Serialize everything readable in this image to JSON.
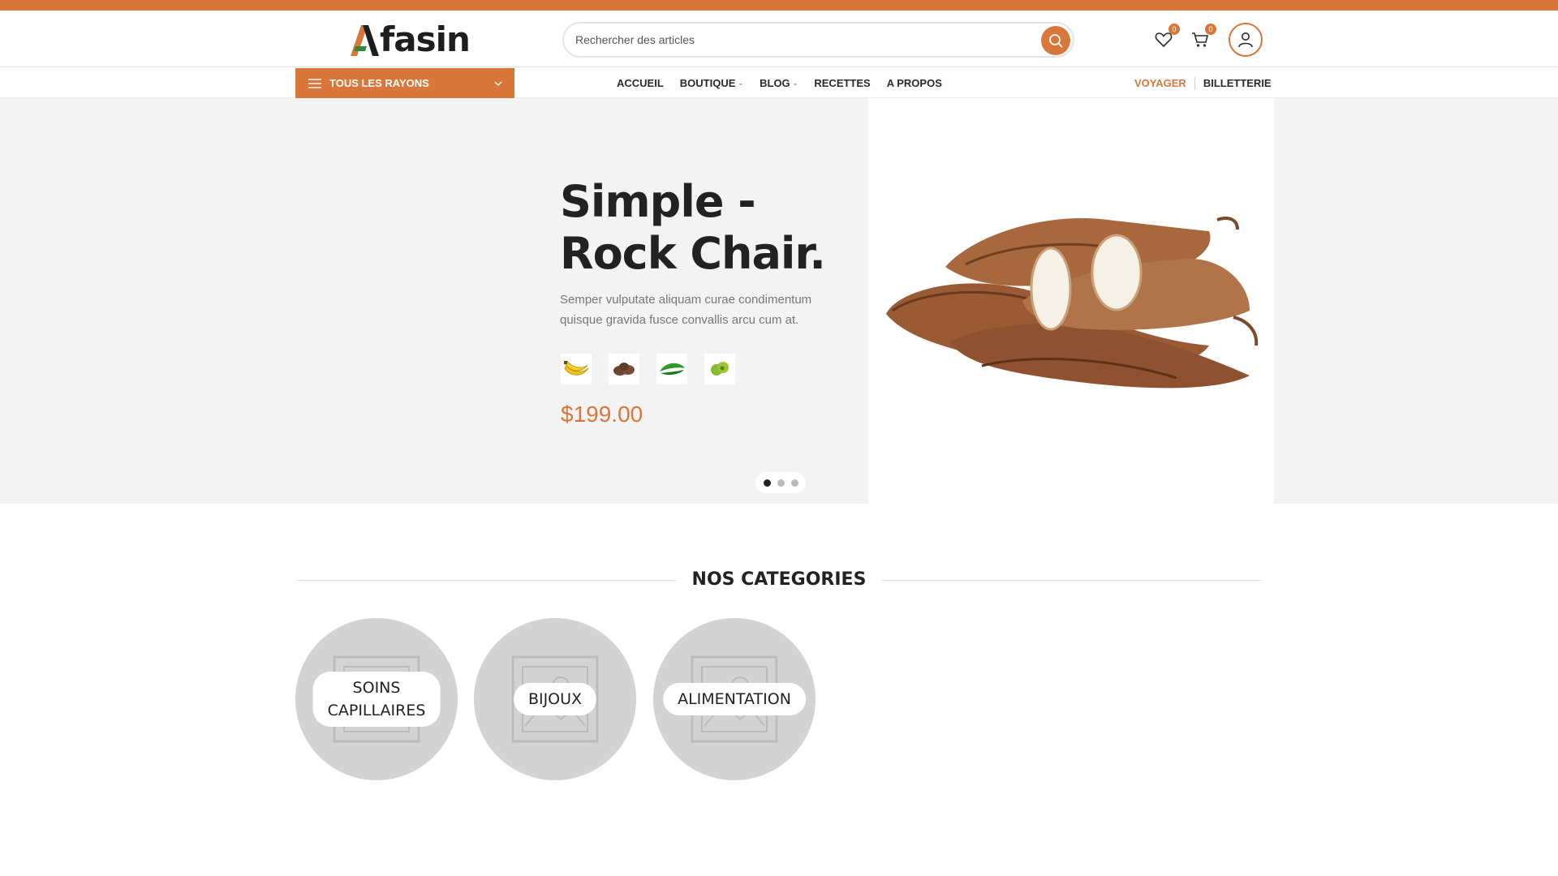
{
  "brand": {
    "name": "fasin",
    "accent_color": "#d9763a",
    "logo_mark_colors": [
      "#d9763a",
      "#2e8b3c"
    ]
  },
  "header": {
    "search": {
      "placeholder": "Rechercher des articles",
      "icon": "search-icon"
    },
    "wishlist": {
      "icon": "heart-icon",
      "count": "0"
    },
    "cart": {
      "icon": "cart-icon",
      "count": "0"
    },
    "account": {
      "icon": "user-icon"
    }
  },
  "nav": {
    "departments_label": "TOUS LES RAYONS",
    "menu": [
      {
        "label": "ACCUEIL",
        "has_dropdown": false
      },
      {
        "label": "BOUTIQUE",
        "has_dropdown": true
      },
      {
        "label": "BLOG",
        "has_dropdown": true
      },
      {
        "label": "RECETTES",
        "has_dropdown": false
      },
      {
        "label": "A PROPOS",
        "has_dropdown": false
      }
    ],
    "voyager": "VOYAGER",
    "billetterie": "BILLETTERIE"
  },
  "hero": {
    "title_line1": "Simple -",
    "title_line2": "Rock Chair.",
    "description": "Semper vulputate aliquam curae condimentum quisque gravida fusce convallis arcu cum at.",
    "thumbnails": [
      "banana",
      "brown-tubers",
      "green-leaves",
      "green-fruit"
    ],
    "price": "$199.00",
    "slides": {
      "count": 3,
      "active": 1
    },
    "image": "cassava-roots"
  },
  "categories": {
    "title": "NOS CATEGORIES",
    "items": [
      {
        "line1": "SOINS",
        "line2": "CAPILLAIRES"
      },
      {
        "line1": "BIJOUX",
        "line2": ""
      },
      {
        "line1": "ALIMENTATION",
        "line2": ""
      }
    ]
  }
}
